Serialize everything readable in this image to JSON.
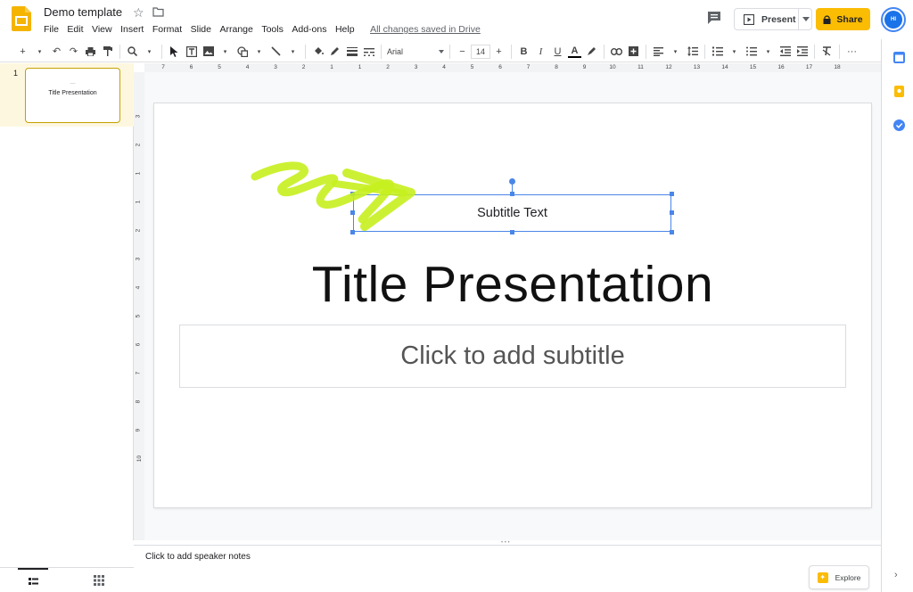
{
  "app": {
    "doc_title": "Demo template",
    "saved_status": "All changes saved in Drive",
    "menu": [
      "File",
      "Edit",
      "View",
      "Insert",
      "Format",
      "Slide",
      "Arrange",
      "Tools",
      "Add-ons",
      "Help"
    ],
    "present_label": "Present",
    "share_label": "Share",
    "avatar_initials": "HI"
  },
  "toolbar": {
    "font_name": "Arial",
    "font_size": "14",
    "bold": "B",
    "italic": "I",
    "underline": "U",
    "text_color": "A",
    "more": "···",
    "minus": "−",
    "plus": "+"
  },
  "filmstrip": {
    "slides": [
      {
        "number": "1",
        "thumb_subtitle": "——",
        "thumb_title": "Title Presentation"
      }
    ]
  },
  "ruler": {
    "horizontal": [
      "7",
      "6",
      "5",
      "4",
      "3",
      "2",
      "1",
      "1",
      "2",
      "3",
      "4",
      "5",
      "6",
      "7",
      "8",
      "9",
      "10",
      "11",
      "12",
      "13",
      "14",
      "15",
      "16",
      "17",
      "18"
    ],
    "vertical": [
      "3",
      "2",
      "1",
      "1",
      "2",
      "3",
      "4",
      "5",
      "6",
      "7",
      "8",
      "9",
      "10"
    ]
  },
  "slide": {
    "subtitle_box_text": "Subtitle Text",
    "title": "Title Presentation",
    "subtitle_placeholder": "Click to add subtitle"
  },
  "notes": {
    "placeholder": "Click to add speaker notes",
    "explore_label": "Explore"
  },
  "colors": {
    "accent_blue": "#4a86e8",
    "share_yellow": "#fbbc04",
    "highlighter_green": "#c6f01e",
    "selected_slide_bg": "#fef7e0"
  }
}
